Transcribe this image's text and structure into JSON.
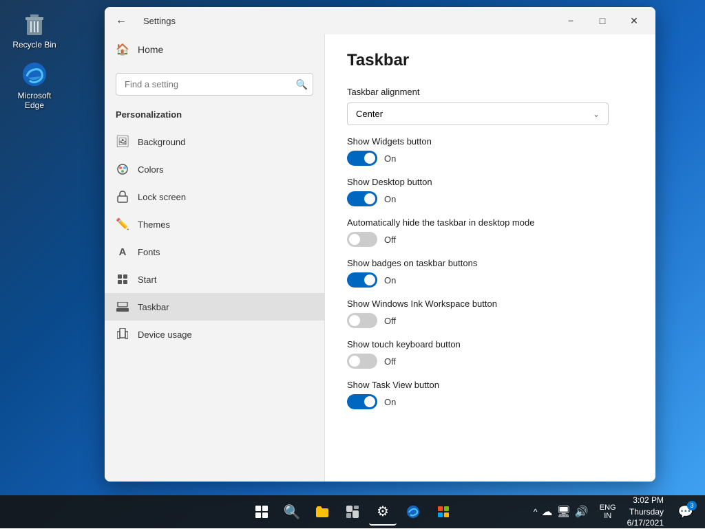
{
  "desktop": {
    "icons": [
      {
        "id": "recycle-bin",
        "label": "Recycle Bin",
        "emoji": "🗑️"
      },
      {
        "id": "microsoft-edge",
        "label": "Microsoft Edge",
        "emoji": "🌐"
      }
    ]
  },
  "taskbar": {
    "center_items": [
      {
        "id": "start",
        "emoji": "⊞",
        "label": "Start"
      },
      {
        "id": "search",
        "emoji": "🔍",
        "label": "Search"
      },
      {
        "id": "file-explorer",
        "emoji": "📁",
        "label": "File Explorer"
      },
      {
        "id": "task-view",
        "emoji": "⧉",
        "label": "Task View"
      },
      {
        "id": "settings",
        "emoji": "⚙",
        "label": "Settings",
        "active": true
      },
      {
        "id": "edge",
        "emoji": "🌐",
        "label": "Edge"
      },
      {
        "id": "store",
        "emoji": "🛒",
        "label": "Microsoft Store"
      }
    ],
    "sys_tray": {
      "chevron": "^",
      "network": "📶",
      "volume": "🔊",
      "language": "ENG\nIN",
      "time": "3:02 PM",
      "date": "Thursday",
      "date2": "6/17/2021",
      "notification_count": "3"
    }
  },
  "settings": {
    "title_bar": {
      "title": "Settings"
    },
    "search": {
      "placeholder": "Find a setting"
    },
    "nav": {
      "home_label": "Home",
      "personalization_header": "Personalization",
      "items": [
        {
          "id": "background",
          "label": "Background",
          "icon": "🖼"
        },
        {
          "id": "colors",
          "label": "Colors",
          "icon": "🎨"
        },
        {
          "id": "lock-screen",
          "label": "Lock screen",
          "icon": "🖥"
        },
        {
          "id": "themes",
          "label": "Themes",
          "icon": "✏"
        },
        {
          "id": "fonts",
          "label": "Fonts",
          "icon": "A"
        },
        {
          "id": "start",
          "label": "Start",
          "icon": "⊞"
        },
        {
          "id": "taskbar",
          "label": "Taskbar",
          "icon": "▬",
          "active": true
        },
        {
          "id": "device-usage",
          "label": "Device usage",
          "icon": "📱"
        }
      ]
    },
    "content": {
      "page_title": "Taskbar",
      "taskbar_alignment_label": "Taskbar alignment",
      "taskbar_alignment_value": "Center",
      "settings": [
        {
          "id": "show-widgets",
          "label": "Show Widgets button",
          "state": "on",
          "state_label": "On"
        },
        {
          "id": "show-desktop",
          "label": "Show Desktop button",
          "state": "on",
          "state_label": "On"
        },
        {
          "id": "auto-hide",
          "label": "Automatically hide the taskbar in desktop mode",
          "state": "off",
          "state_label": "Off"
        },
        {
          "id": "show-badges",
          "label": "Show badges on taskbar buttons",
          "state": "on",
          "state_label": "On"
        },
        {
          "id": "windows-ink",
          "label": "Show Windows Ink Workspace button",
          "state": "off",
          "state_label": "Off"
        },
        {
          "id": "touch-keyboard",
          "label": "Show touch keyboard button",
          "state": "off",
          "state_label": "Off"
        },
        {
          "id": "task-view",
          "label": "Show Task View button",
          "state": "on",
          "state_label": "On"
        }
      ]
    }
  },
  "colors": {
    "accent": "#0067c0",
    "toggle_on": "#0067c0",
    "toggle_off": "#cccccc"
  }
}
